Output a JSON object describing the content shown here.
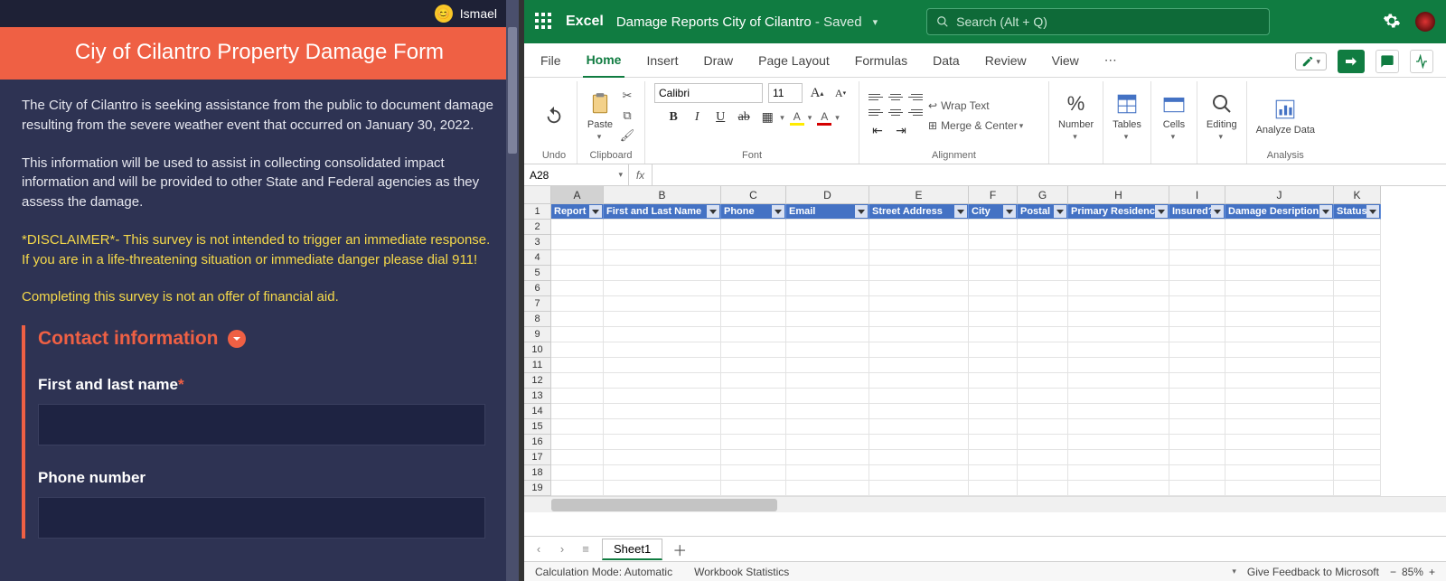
{
  "form": {
    "user_name": "Ismael",
    "title": "Ciy of Cilantro Property Damage Form",
    "intro": "The City of Cilantro is seeking assistance from the public to document damage resulting from the severe weather event that occurred on January 30, 2022.",
    "purpose": "This information will be used to assist in collecting consolidated impact information and will be provided to other State and Federal agencies as they assess the damage.",
    "disclaimer1": "*DISCLAIMER*- This survey is not intended to trigger an immediate response. If you are in a life-threatening situation or immediate danger please dial 911!",
    "disclaimer2": "Completing this survey is not an offer of financial aid.",
    "section_head": "Contact information",
    "fld_name_label": "First and last name",
    "fld_phone_label": "Phone number"
  },
  "excel": {
    "brand": "Excel",
    "filename": "Damage Reports City of Cilantro",
    "saved_state": "Saved",
    "search_placeholder": "Search (Alt + Q)",
    "tabs": [
      "File",
      "Home",
      "Insert",
      "Draw",
      "Page Layout",
      "Formulas",
      "Data",
      "Review",
      "View"
    ],
    "active_tab": "Home",
    "ribbon": {
      "undo": "Undo",
      "paste": "Paste",
      "clipboard": "Clipboard",
      "font_name": "Calibri",
      "font_size": "11",
      "font": "Font",
      "alignment": "Alignment",
      "wrap": "Wrap Text",
      "merge": "Merge & Center",
      "number": "Number",
      "tables": "Tables",
      "cells": "Cells",
      "editing": "Editing",
      "analyze": "Analyze Data",
      "analysis": "Analysis"
    },
    "name_box": "A28",
    "columns": [
      "A",
      "B",
      "C",
      "D",
      "E",
      "F",
      "G",
      "H",
      "I",
      "J",
      "K"
    ],
    "header_row": [
      "Report ID",
      "First and Last Name",
      "Phone",
      "Email",
      "Street Address",
      "City",
      "Postal",
      "Primary Residence?",
      "Insured?",
      "Damage Desription",
      "Status"
    ],
    "row_count": 19,
    "sheet_name": "Sheet1",
    "calc_mode": "Calculation Mode: Automatic",
    "wb_stats": "Workbook Statistics",
    "feedback": "Give Feedback to Microsoft",
    "zoom": "85%"
  }
}
